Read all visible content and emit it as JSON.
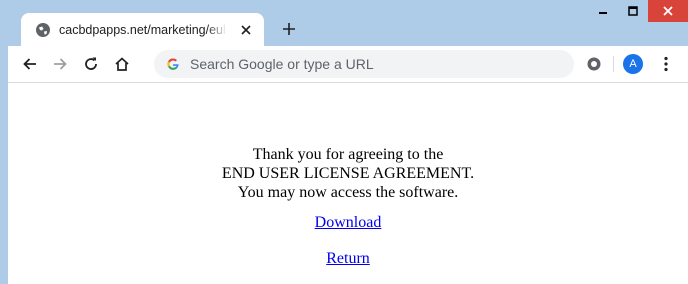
{
  "browser": {
    "tab": {
      "title": "cacbdpapps.net/marketing/eula/",
      "favicon_icon": "globe-icon",
      "close_icon": "close-icon"
    },
    "new_tab_icon": "plus-icon",
    "window_controls": {
      "minimize_icon": "minimize-icon",
      "maximize_icon": "maximize-icon",
      "close_icon": "window-close-icon"
    },
    "toolbar": {
      "back_icon": "arrow-left-icon",
      "forward_icon": "arrow-right-icon",
      "reload_icon": "reload-icon",
      "home_icon": "home-icon",
      "omnibox_icon": "google-g-icon",
      "omnibox_placeholder": "Search Google or type a URL",
      "extension_icon": "extension-icon",
      "avatar_letter": "A",
      "menu_icon": "kebab-menu-icon"
    },
    "colors": {
      "frame": "#aecbe8",
      "close_button": "#d9443a",
      "avatar": "#1a73e8",
      "link": "#0000ee"
    }
  },
  "page": {
    "message": {
      "line1": "Thank you for agreeing to the",
      "line2": "END USER LICENSE AGREEMENT.",
      "line3": "You may now access the software."
    },
    "links": {
      "download": "Download",
      "return": "Return"
    }
  }
}
